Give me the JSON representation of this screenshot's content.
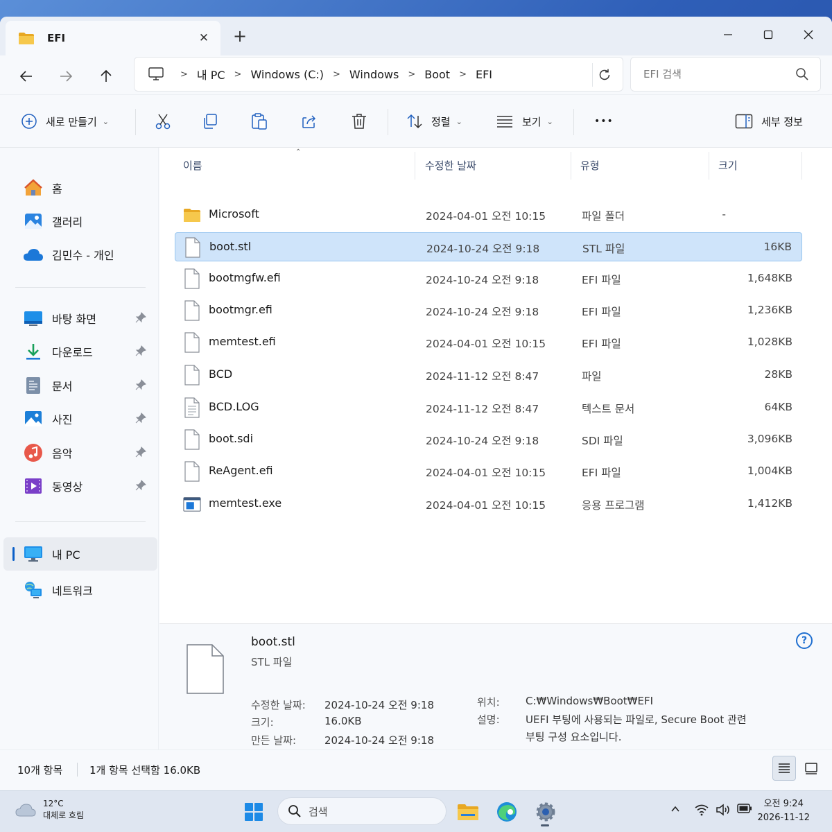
{
  "tab": {
    "title": "EFI",
    "close": "✕",
    "add": "+"
  },
  "window_controls": {
    "minimize": "—",
    "maximize": "☐",
    "close": "✕"
  },
  "breadcrumbs": [
    "내 PC",
    "Windows (C:)",
    "Windows",
    "Boot",
    "EFI"
  ],
  "search": {
    "placeholder": "EFI 검색"
  },
  "commands": {
    "new": "새로 만들기",
    "sort": "정렬",
    "view": "보기",
    "more": "•••",
    "details": "세부 정보"
  },
  "sidebar": {
    "top": [
      {
        "label": "홈",
        "icon": "home-icon"
      },
      {
        "label": "갤러리",
        "icon": "gallery-icon"
      },
      {
        "label": "김민수 - 개인",
        "icon": "onedrive-cloud-icon"
      }
    ],
    "pinned": [
      {
        "label": "바탕 화면",
        "icon": "desktop-icon"
      },
      {
        "label": "다운로드",
        "icon": "download-icon"
      },
      {
        "label": "문서",
        "icon": "documents-icon"
      },
      {
        "label": "사진",
        "icon": "pictures-icon"
      },
      {
        "label": "음악",
        "icon": "music-icon"
      },
      {
        "label": "동영상",
        "icon": "videos-icon"
      }
    ],
    "bottom": [
      {
        "label": "내 PC",
        "icon": "this-pc-icon",
        "active": true
      },
      {
        "label": "네트워크",
        "icon": "network-icon"
      }
    ]
  },
  "columns": {
    "name": "이름",
    "date": "수정한 날짜",
    "type": "유형",
    "size": "크기"
  },
  "files": [
    {
      "name": "Microsoft",
      "date": "2024-04-01 오전 10:15",
      "type": "파일 폴더",
      "size": "-",
      "icon": "folder-icon"
    },
    {
      "name": "boot.stl",
      "date": "2024-10-24 오전 9:18",
      "type": "STL 파일",
      "size": "16KB",
      "icon": "file-icon",
      "selected": true
    },
    {
      "name": "bootmgfw.efi",
      "date": "2024-10-24 오전 9:18",
      "type": "EFI 파일",
      "size": "1,648KB",
      "icon": "file-icon"
    },
    {
      "name": "bootmgr.efi",
      "date": "2024-10-24 오전 9:18",
      "type": "EFI 파일",
      "size": "1,236KB",
      "icon": "file-icon"
    },
    {
      "name": "memtest.efi",
      "date": "2024-04-01 오전 10:15",
      "type": "EFI 파일",
      "size": "1,028KB",
      "icon": "file-icon"
    },
    {
      "name": "BCD",
      "date": "2024-11-12 오전 8:47",
      "type": "파일",
      "size": "28KB",
      "icon": "file-icon"
    },
    {
      "name": "BCD.LOG",
      "date": "2024-11-12 오전 8:47",
      "type": "텍스트 문서",
      "size": "64KB",
      "icon": "text-file-icon"
    },
    {
      "name": "boot.sdi",
      "date": "2024-10-24 오전 9:18",
      "type": "SDI 파일",
      "size": "3,096KB",
      "icon": "file-icon"
    },
    {
      "name": "ReAgent.efi",
      "date": "2024-04-01 오전 10:15",
      "type": "EFI 파일",
      "size": "1,004KB",
      "icon": "file-icon"
    },
    {
      "name": "memtest.exe",
      "date": "2024-04-01 오전 10:15",
      "type": "응용 프로그램",
      "size": "1,412KB",
      "icon": "application-icon"
    }
  ],
  "details_pane": {
    "name": "boot.stl",
    "type": "STL 파일",
    "modified_label": "수정한 날짜:",
    "modified": "2024-10-24 오전 9:18",
    "size_label": "크기:",
    "size": "16.0KB",
    "created_label": "만든 날짜:",
    "created": "2024-10-24 오전 9:18",
    "location_label": "위치:",
    "location": "C:₩Windows₩Boot₩EFI",
    "description_label": "설명:",
    "description_line1": "UEFI 부팅에 사용되는 파일로, Secure Boot 관련",
    "description_line2": "부팅 구성 요소입니다.",
    "help": "?"
  },
  "status": {
    "count": "10개 항목",
    "selection": "1개 항목 선택함 16.0KB"
  },
  "taskbar": {
    "weather_temp": "12°C",
    "weather_desc": "대체로 흐림",
    "search_placeholder": "검색",
    "clock_time": "오전 9:24",
    "clock_date": "2026-11-12"
  },
  "colors": {
    "accent": "#0a5fc8",
    "selection": "#cfe4fa",
    "folder": "#f4c542"
  }
}
